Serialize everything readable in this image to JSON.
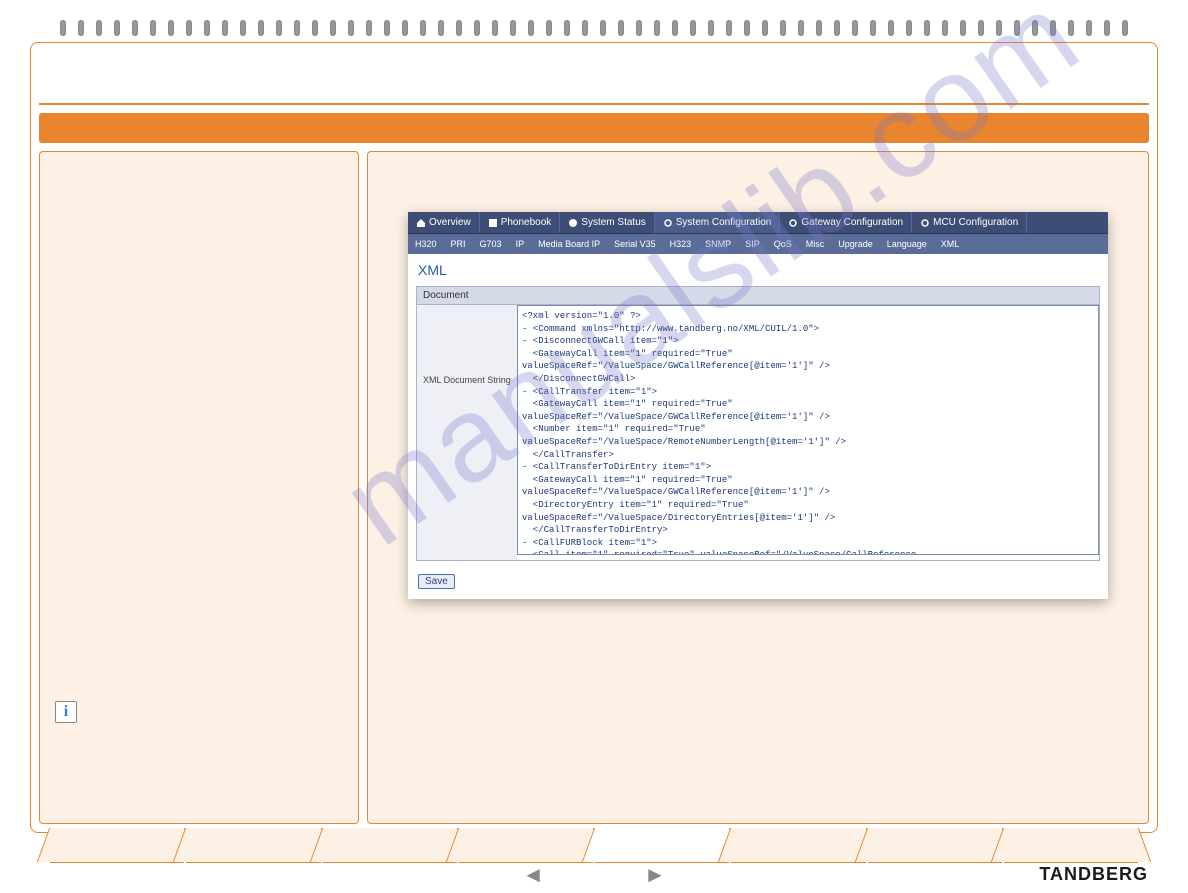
{
  "brand": "TANDBERG",
  "watermark": "manualslib.com",
  "info_icon_glyph": "i",
  "screenshot": {
    "top_tabs": [
      {
        "label": "Overview",
        "icon": "home"
      },
      {
        "label": "Phonebook",
        "icon": "book"
      },
      {
        "label": "System Status",
        "icon": "status"
      },
      {
        "label": "System Configuration",
        "icon": "gear",
        "active": true
      },
      {
        "label": "Gateway Configuration",
        "icon": "gear"
      },
      {
        "label": "MCU Configuration",
        "icon": "gear"
      }
    ],
    "sub_tabs": [
      "H320",
      "PRI",
      "G703",
      "IP",
      "Media Board IP",
      "Serial V35",
      "H323",
      "SNMP",
      "SIP",
      "QoS",
      "Misc",
      "Upgrade",
      "Language",
      "XML"
    ],
    "section_title": "XML",
    "doc_header": "Document",
    "doc_label": "XML Document String",
    "xml_content": "<?xml version=\"1.0\" ?>\n- <Command xmlns=\"http://www.tandberg.no/XML/CUIL/1.0\">\n- <DisconnectGWCall item=\"1\">\n  <GatewayCall item=\"1\" required=\"True\"\nvalueSpaceRef=\"/ValueSpace/GWCallReference[@item='1']\" />\n  </DisconnectGWCall>\n- <CallTransfer item=\"1\">\n  <GatewayCall item=\"1\" required=\"True\"\nvalueSpaceRef=\"/ValueSpace/GWCallReference[@item='1']\" />\n  <Number item=\"1\" required=\"True\"\nvalueSpaceRef=\"/ValueSpace/RemoteNumberLength[@item='1']\" />\n  </CallTransfer>\n- <CallTransferToDirEntry item=\"1\">\n  <GatewayCall item=\"1\" required=\"True\"\nvalueSpaceRef=\"/ValueSpace/GWCallReference[@item='1']\" />\n  <DirectoryEntry item=\"1\" required=\"True\"\nvalueSpaceRef=\"/ValueSpace/DirectoryEntries[@item='1']\" />\n  </CallTransferToDirEntry>\n- <CallFURBlock item=\"1\">\n  <Call item=\"1\" required=\"True\" valueSpaceRef=\"/ValueSpace/CallReference",
    "save_label": "Save"
  },
  "nav": {
    "prev": "◄",
    "next": "►"
  }
}
